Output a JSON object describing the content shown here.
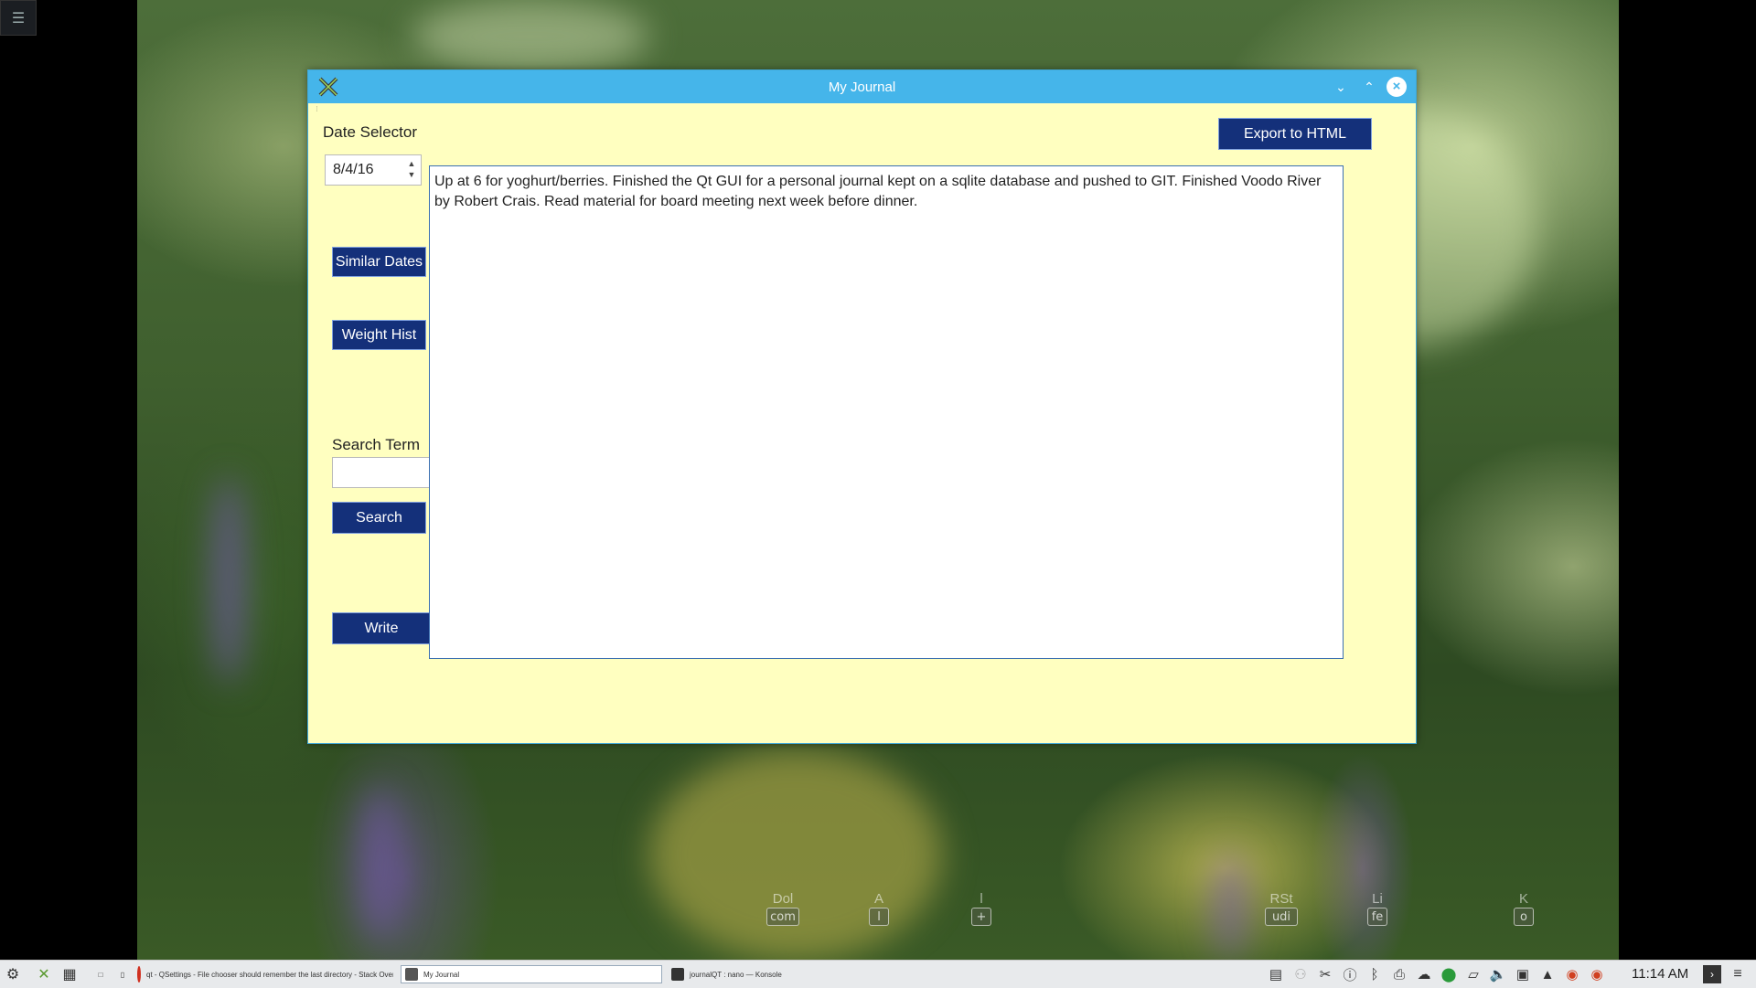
{
  "window": {
    "title": "My Journal",
    "min_glyph": "⌄",
    "max_glyph": "⌃",
    "close_glyph": "×"
  },
  "sidebar": {
    "date_selector_label": "Date Selector",
    "date_value": "8/4/16",
    "similar_dates_label": "Similar Dates",
    "weight_hist_label": "Weight Hist",
    "search_term_label": "Search Term",
    "search_input_value": "",
    "search_label": "Search",
    "write_label": "Write"
  },
  "toolbar": {
    "export_label": "Export to HTML"
  },
  "journal": {
    "entry_text": "Up at 6 for yoghurt/berries.  Finished the Qt GUI for a personal journal kept on a sqlite database and pushed to GIT.  Finished Voodo River by Robert Crais.  Read material for board meeting next week before dinner."
  },
  "desktop_icons": [
    {
      "label": "Dol",
      "box": "com"
    },
    {
      "label": "A",
      "box": "l"
    },
    {
      "label": "l",
      "box": "+"
    },
    {
      "label": "RSt",
      "box": "udi"
    },
    {
      "label": "Li",
      "box": "fe"
    },
    {
      "label": "K",
      "box": "o"
    }
  ],
  "taskbar": {
    "tasks": [
      {
        "label": "qt - QSettings - File chooser should remember the last directory - Stack Overflow",
        "icon_color": "#e8a020"
      },
      {
        "label": "My Journal",
        "icon_color": "#555555"
      },
      {
        "label": "journalQT : nano — Konsole",
        "icon_color": "#333333"
      }
    ],
    "clock": "11:14 AM",
    "colors": {
      "accent": "#45b5ea",
      "button": "#14307a",
      "window_bg": "#ffffc0"
    }
  }
}
